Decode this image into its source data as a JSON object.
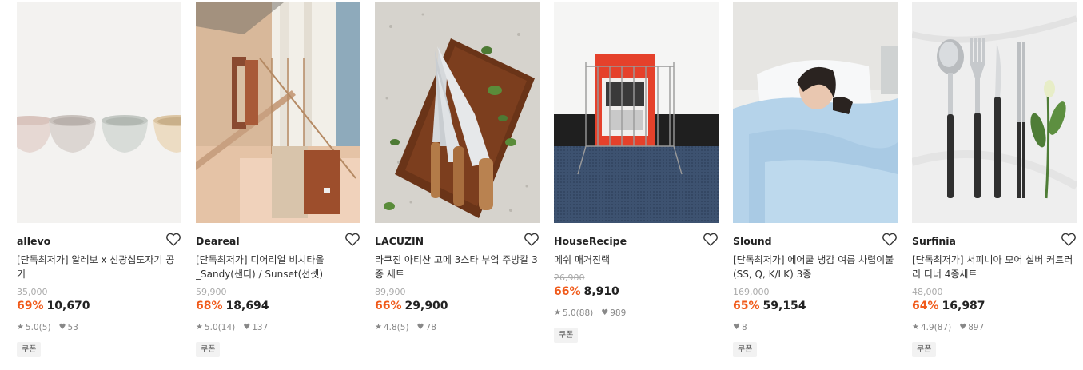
{
  "products": [
    {
      "brand": "allevo",
      "title": "[단독최저가] 알레보 x 신광섭도자기 공기",
      "original_price": "35,000",
      "discount": "69%",
      "price": "10,670",
      "rating": "5.0",
      "review_count": "(5)",
      "likes": "53",
      "badge": "쿠폰",
      "image": "ceramic-bowls"
    },
    {
      "brand": "Deareal",
      "title": "[단독최저가] 디어리얼 비치타올 _Sandy(샌디) / Sunset(선셋)",
      "original_price": "59,900",
      "discount": "68%",
      "price": "18,694",
      "rating": "5.0",
      "review_count": "(14)",
      "likes": "137",
      "badge": "쿠폰",
      "image": "beach-towels"
    },
    {
      "brand": "LACUZIN",
      "title": "라쿠진 아티산 고메 3스타 부엌 주방칼 3종 세트",
      "original_price": "89,900",
      "discount": "66%",
      "price": "29,900",
      "rating": "4.8",
      "review_count": "(5)",
      "likes": "78",
      "badge": "",
      "image": "kitchen-knives"
    },
    {
      "brand": "HouseRecipe",
      "title": "메쉬 매거진랙",
      "original_price": "26,900",
      "discount": "66%",
      "price": "8,910",
      "rating": "5.0",
      "review_count": "(88)",
      "likes": "989",
      "badge": "쿠폰",
      "image": "magazine-rack"
    },
    {
      "brand": "Slound",
      "title": "[단독최저가] 에어쿨 냉감 여름 차렵이불 (SS, Q, K/LK) 3종",
      "original_price": "169,000",
      "discount": "65%",
      "price": "59,154",
      "rating": "",
      "review_count": "",
      "likes": "8",
      "badge": "쿠폰",
      "image": "summer-blanket"
    },
    {
      "brand": "Surfinia",
      "title": "[단독최저가] 서피니아 모어 실버 커트러리 디너 4종세트",
      "original_price": "48,000",
      "discount": "64%",
      "price": "16,987",
      "rating": "4.9",
      "review_count": "(87)",
      "likes": "897",
      "badge": "쿠폰",
      "image": "cutlery-set"
    }
  ],
  "colors": {
    "discount": "#f05a1a",
    "strike_price": "#aaaaaa",
    "badge_bg": "#f2f2f2"
  },
  "icons": {
    "heart": "heart-outline-icon",
    "star": "star-icon",
    "like": "heart-filled-icon"
  }
}
